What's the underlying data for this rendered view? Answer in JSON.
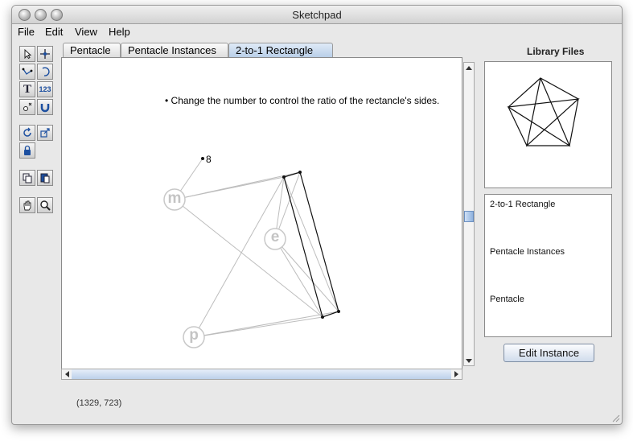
{
  "window": {
    "title": "Sketchpad"
  },
  "menu": {
    "file": "File",
    "edit": "Edit",
    "view": "View",
    "help": "Help"
  },
  "tabs": [
    "Pentacle",
    "Pentacle Instances",
    "2-to-1 Rectangle"
  ],
  "canvas": {
    "instruction": "Change the number to control the ratio of the rectancle's sides.",
    "number_label": "8",
    "point_labels": {
      "m": "m",
      "e": "e",
      "p": "p"
    }
  },
  "tools": {
    "text_tool": "T",
    "number_tool": "123"
  },
  "library": {
    "title": "Library Files",
    "items": [
      "2-to-1 Rectangle",
      "Pentacle Instances",
      "Pentacle"
    ],
    "edit_button": "Edit Instance"
  },
  "status": {
    "coords": "(1329, 723)"
  }
}
